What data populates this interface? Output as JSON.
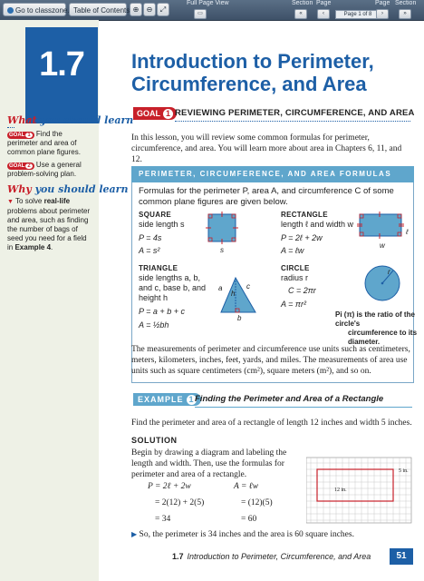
{
  "toolbar": {
    "go_to_classzone": "Go to classzone.com",
    "table_of_contents": "Table of Contents",
    "full_page_view": "Full Page View",
    "section": "Section",
    "page": "Page",
    "page_indicator": "Page 1 of 8",
    "page_right": "Page",
    "section_right": "Section"
  },
  "sidebar": {
    "lesson_number": "1.7",
    "what_head_lead": "What",
    "what_head_rest": " you should learn",
    "goal_label": "GOAL",
    "goal1_num": "1",
    "goal1_text": "Find the perimeter and area of common plane figures.",
    "goal2_num": "2",
    "goal2_text": "Use a general problem-solving plan.",
    "why_head_lead": "Why",
    "why_head_rest": " you should learn it",
    "why_text_1": "To solve ",
    "why_text_bold": "real-life",
    "why_text_2": " problems about perimeter and area, such as finding the number of bags of seed you need for a field in ",
    "why_text_example": "Example 4",
    "why_text_3": "."
  },
  "main": {
    "title_line1": "Introduction to Perimeter,",
    "title_line2": "Circumference, and Area",
    "goal_badge": "GOAL",
    "goal_badge_num": "1",
    "goal_title": "REVIEWING PERIMETER, CIRCUMFERENCE, AND AREA",
    "intro": "In this lesson, you will review some common formulas for perimeter, circumference, and area. You will learn more about area in Chapters 6, 11, and 12.",
    "formulas": {
      "header": "PERIMETER, CIRCUMFERENCE, AND AREA FORMULAS",
      "intro": "Formulas for the perimeter P, area A, and circumference C of some common plane figures are given below.",
      "square_cap": "SQUARE",
      "square_desc": "side length s",
      "square_p": "P = 4s",
      "square_a": "A = s²",
      "square_label": "s",
      "rect_cap": "RECTANGLE",
      "rect_desc": "length ℓ and width w",
      "rect_p": "P = 2ℓ + 2w",
      "rect_a": "A = ℓw",
      "rect_l": "ℓ",
      "rect_w": "w",
      "tri_cap": "TRIANGLE",
      "tri_desc1": "side lengths a, b,",
      "tri_desc2": "and c, base b, and",
      "tri_desc3": "height h",
      "tri_p": "P = a + b + c",
      "tri_a": "A = ½bh",
      "tri_a_label": "a",
      "tri_h_label": "h",
      "tri_c_label": "c",
      "tri_b_label": "b",
      "circ_cap": "CIRCLE",
      "circ_desc": "radius r",
      "circ_c": "C = 2πr",
      "circ_a": "A = πr²",
      "circ_r_label": "r",
      "pi_note1": "Pi (π) is the ratio of the circle's",
      "pi_note2": "circumference to its diameter."
    },
    "units_para": "The measurements of perimeter and circumference use units such as centimeters, meters, kilometers, inches, feet, yards, and miles. The measurements of area use units such as square centimeters (cm²), square meters (m²), and so on.",
    "example_badge": "EXAMPLE",
    "example_num": "1",
    "example_title": "Finding the Perimeter and Area of a Rectangle",
    "example_prompt": "Find the perimeter and area of a rectangle of length 12 inches and width 5 inches.",
    "solution_label": "SOLUTION",
    "solution_text": "Begin by drawing a diagram and labeling the length and width. Then, use the formulas for perimeter and area of a rectangle.",
    "eq_p1": "P = 2ℓ + 2w",
    "eq_p2": "= 2(12) + 2(5)",
    "eq_p3": "= 34",
    "eq_a1": "A = ℓw",
    "eq_a2": "= (12)(5)",
    "eq_a3": "= 60",
    "grid_width_label": "5 in.",
    "grid_length_label": "12 in.",
    "conclusion": "So, the perimeter is 34 inches and the area is 60 square inches."
  },
  "footer": {
    "lesson": "1.7",
    "title": "Introduction to Perimeter, Circumference, and Area",
    "page_number": "51"
  },
  "colors": {
    "brand_blue": "#1d5fa6",
    "accent_red": "#c8202a",
    "light_blue": "#5fa6cc",
    "sidebar_bg": "#eef1e6"
  }
}
